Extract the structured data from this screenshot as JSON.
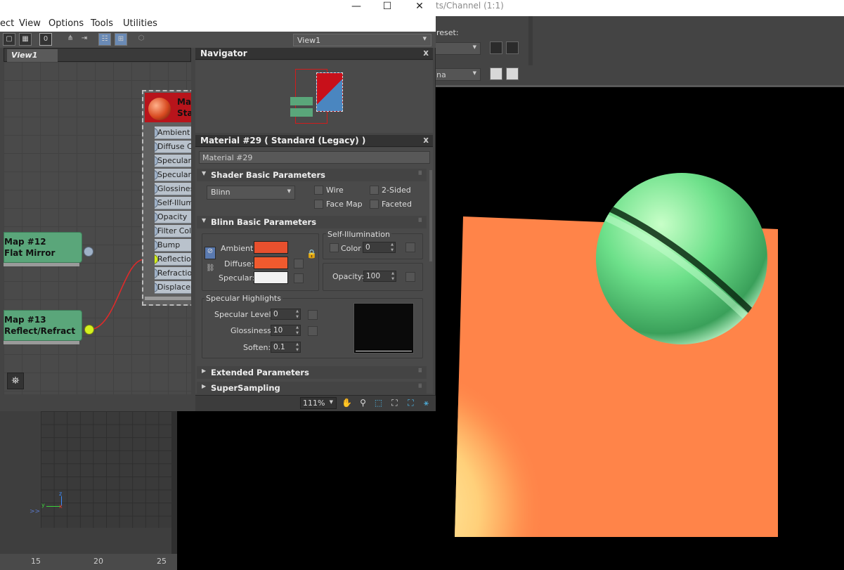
{
  "render_window": {
    "title": "ts/Channel (1:1)",
    "preset_label": "reset:",
    "viewport_combo": "na"
  },
  "viewport": {
    "ruler_ticks": [
      "15",
      "20",
      "25"
    ],
    "axis_z": "z",
    "axis_x": "x",
    "axis_y": "y",
    "expand_glyph": ">>"
  },
  "slate": {
    "menu": [
      "ect",
      "View",
      "Options",
      "Tools",
      "Utilities"
    ],
    "window_buttons": {
      "minimize": "—",
      "maximize": "☐",
      "close": "✕"
    },
    "view_combo": "View1",
    "view_tab": "View1",
    "nodes": {
      "map12": {
        "line1": "Map #12",
        "line2": "Flat Mirror"
      },
      "map13": {
        "line1": "Map #13",
        "line2": "Reflect/Refract"
      },
      "material_header_1": "Ma",
      "material_header_2": "Sta",
      "slots": [
        "Ambient C",
        "Diffuse Co",
        "Specular C",
        "Specular L",
        "Glossines",
        "Self-Illumin",
        "Opacity",
        "Filter Colo",
        "Bump",
        "Reflection",
        "Refraction",
        "Displacem"
      ]
    },
    "navigator": {
      "title": "Navigator",
      "close": "x"
    },
    "material_panel": {
      "title": "Material #29  ( Standard (Legacy) )",
      "close": "x",
      "name_field": "Material #29",
      "shader_rollout": "Shader Basic Parameters",
      "shader_combo": "Blinn",
      "checkbox_wire": "Wire",
      "checkbox_2sided": "2-Sided",
      "checkbox_facemap": "Face Map",
      "checkbox_faceted": "Faceted",
      "blinn_rollout": "Blinn Basic Parameters",
      "ambient_label": "Ambient:",
      "diffuse_label": "Diffuse:",
      "specular_label": "Specular:",
      "self_illum_group": "Self-Illumination",
      "self_illum_color_label": "Color",
      "self_illum_value": "0",
      "opacity_label": "Opacity:",
      "opacity_value": "100",
      "spec_highlights_group": "Specular Highlights",
      "spec_level_label": "Specular Level:",
      "spec_level_value": "0",
      "glossiness_label": "Glossiness:",
      "glossiness_value": "10",
      "soften_label": "Soften:",
      "soften_value": "0.1",
      "extended_rollout": "Extended Parameters",
      "supersampling_rollout": "SuperSampling",
      "colors": {
        "ambient": "#e8502e",
        "diffuse": "#f05a2e",
        "specular": "#f2f2f2"
      }
    },
    "zoom_value": "111%"
  }
}
